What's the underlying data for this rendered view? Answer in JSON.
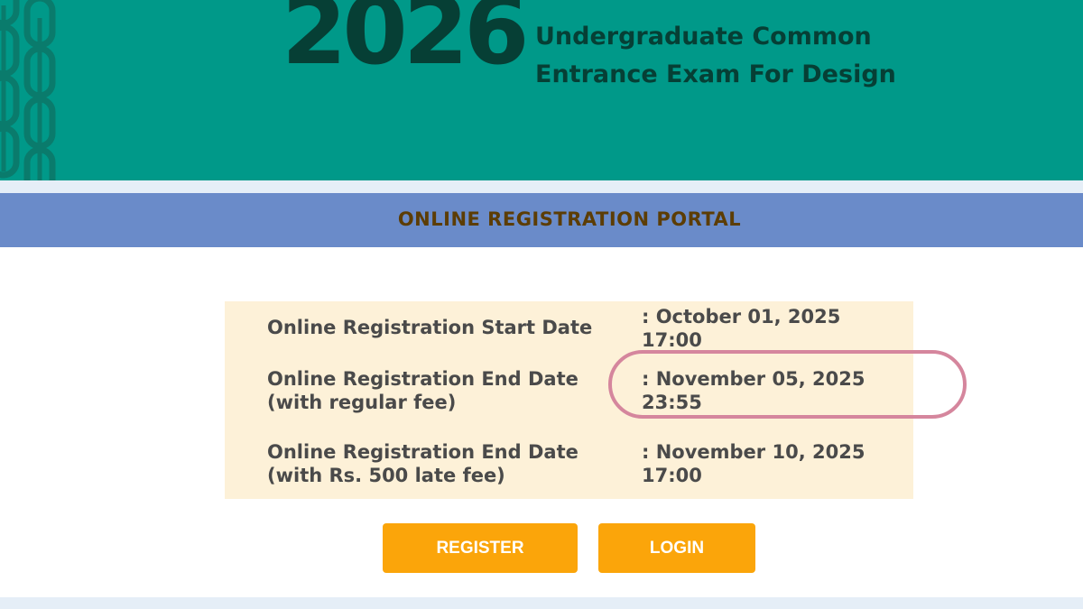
{
  "header": {
    "year": "2026",
    "tagline_line1": "Undergraduate Common",
    "tagline_line2": "Entrance Exam For Design"
  },
  "portal": {
    "title": "ONLINE REGISTRATION PORTAL"
  },
  "dates": [
    {
      "label_line1": "Online Registration Start Date",
      "label_line2": "",
      "value_line1": ": October 01, 2025",
      "value_line2": "17:00"
    },
    {
      "label_line1": "Online Registration End Date",
      "label_line2": "(with regular fee)",
      "value_line1": ": November 05, 2025",
      "value_line2": "23:55"
    },
    {
      "label_line1": "Online Registration End Date",
      "label_line2": "(with Rs. 500 late fee)",
      "value_line1": ": November 10, 2025",
      "value_line2": "17:00"
    }
  ],
  "buttons": {
    "register_label": "REGISTER",
    "login_label": "LOGIN"
  },
  "colors": {
    "banner_bg": "#009989",
    "banner_text": "#063f35",
    "portal_bar": "#6a8bc9",
    "portal_title": "#5c3d05",
    "dates_bg": "#fdf1d8",
    "highlight_ring": "#d5869d",
    "button_bg": "#fba50a"
  }
}
